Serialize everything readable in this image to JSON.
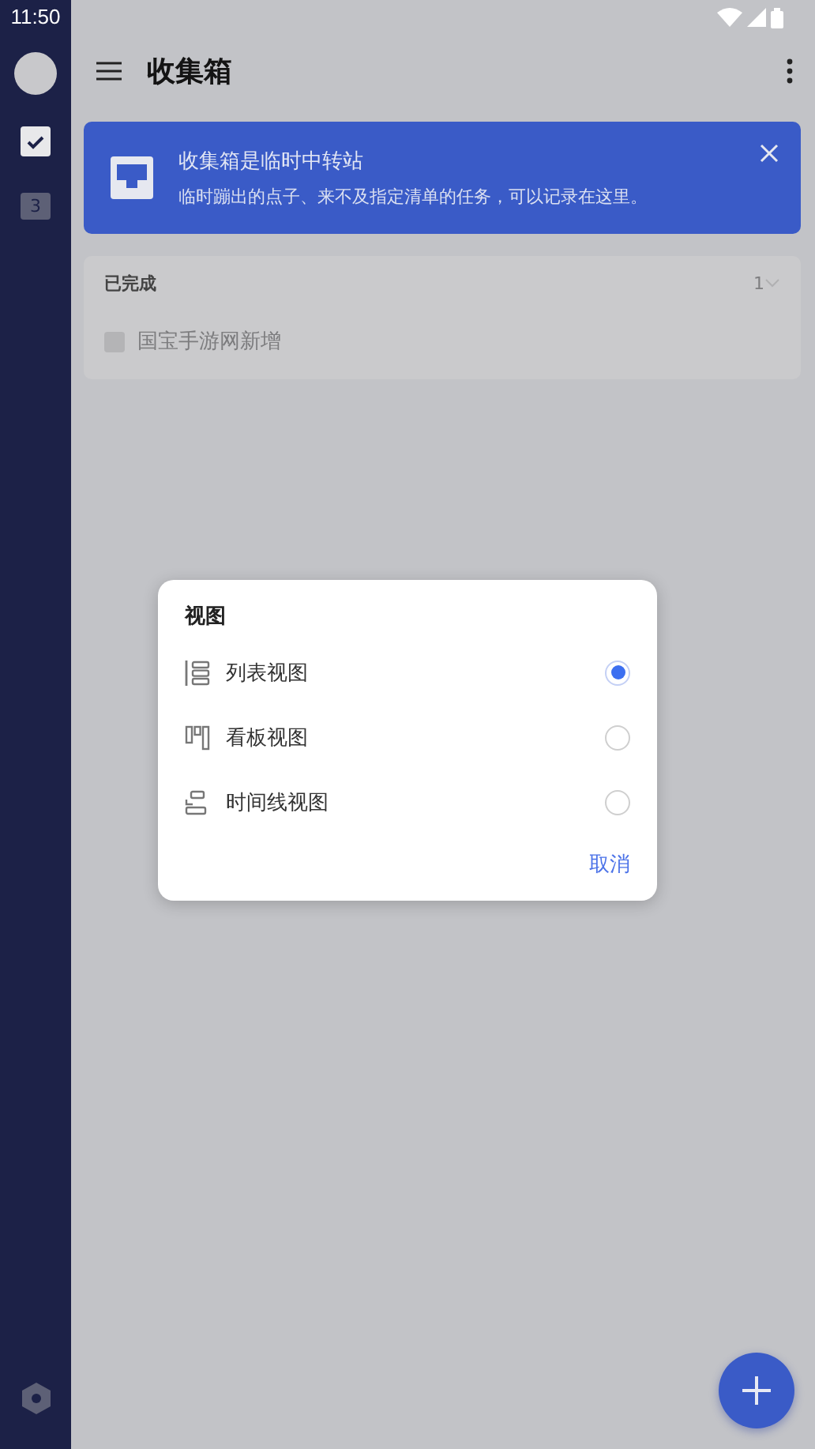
{
  "status_bar": {
    "time": "11:50"
  },
  "sidebar": {
    "items": [
      {
        "kind": "tasks",
        "selected": true
      },
      {
        "kind": "calendar",
        "label": "3",
        "selected": false
      }
    ]
  },
  "toolbar": {
    "title": "收集箱"
  },
  "banner": {
    "title": "收集箱是临时中转站",
    "text": "临时蹦出的点子、来不及指定清单的任务，可以记录在这里。"
  },
  "completed_section": {
    "title": "已完成",
    "count": "1",
    "tasks": [
      {
        "title": "国宝手游网新增",
        "checked": true
      }
    ]
  },
  "dialog": {
    "title": "视图",
    "options": [
      {
        "kind": "list",
        "label": "列表视图",
        "selected": true
      },
      {
        "kind": "kanban",
        "label": "看板视图",
        "selected": false
      },
      {
        "kind": "timeline",
        "label": "时间线视图",
        "selected": false
      }
    ],
    "cancel": "取消"
  }
}
